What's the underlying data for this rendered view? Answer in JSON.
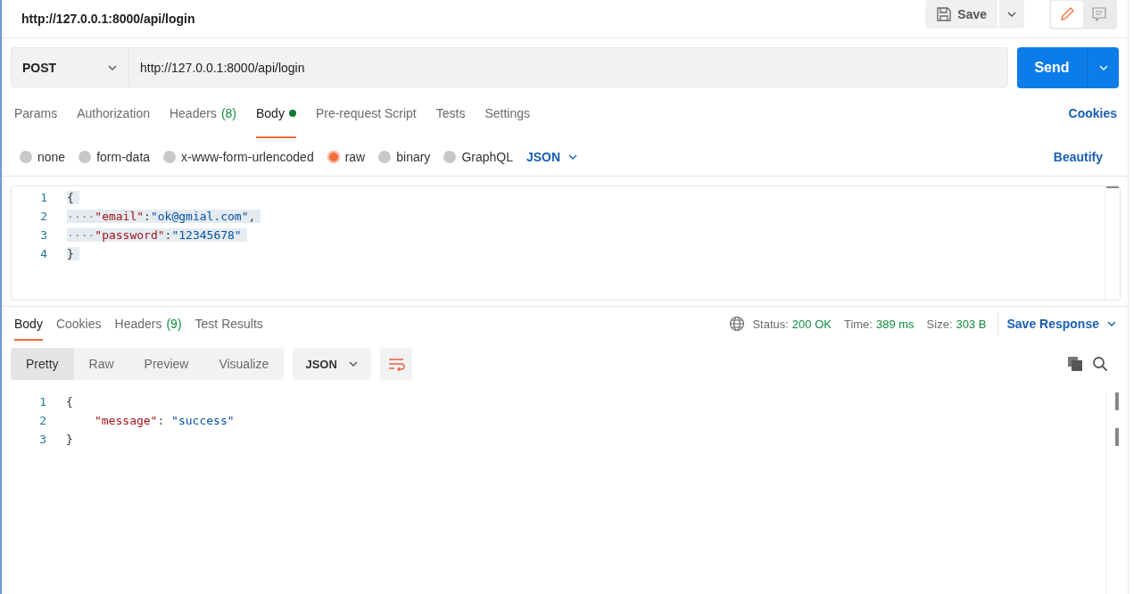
{
  "header": {
    "title": "http://127.0.0.1:8000/api/login",
    "save_label": "Save",
    "modes": [
      {
        "kind": "edit",
        "selected": true
      },
      {
        "kind": "comment",
        "selected": false
      }
    ]
  },
  "request": {
    "method": "POST",
    "url": "http://127.0.0.1:8000/api/login",
    "send_label": "Send"
  },
  "request_tabs": [
    {
      "label": "Params",
      "selected": false
    },
    {
      "label": "Authorization",
      "selected": false
    },
    {
      "label": "Headers",
      "count": "(8)",
      "selected": false
    },
    {
      "label": "Body",
      "selected": true,
      "dot": true
    },
    {
      "label": "Pre-request Script",
      "selected": false
    },
    {
      "label": "Tests",
      "selected": false
    },
    {
      "label": "Settings",
      "selected": false
    }
  ],
  "cookies_link": "Cookies",
  "body_types": [
    {
      "label": "none",
      "selected": false
    },
    {
      "label": "form-data",
      "selected": false
    },
    {
      "label": "x-www-form-urlencoded",
      "selected": false
    },
    {
      "label": "raw",
      "selected": true
    },
    {
      "label": "binary",
      "selected": false
    },
    {
      "label": "GraphQL",
      "selected": false
    }
  ],
  "body_format": "JSON",
  "beautify_link": "Beautify",
  "request_body": [
    {
      "number": "1",
      "tokens": [
        {
          "kind": "punct",
          "text": "{"
        }
      ]
    },
    {
      "number": "2",
      "tokens": [
        {
          "kind": "whitespace",
          "text": "····"
        },
        {
          "kind": "key",
          "text": "\"email\""
        },
        {
          "kind": "punct",
          "text": ":"
        },
        {
          "kind": "string",
          "text": "\"ok@gmial.com\""
        },
        {
          "kind": "punct",
          "text": ","
        }
      ]
    },
    {
      "number": "3",
      "tokens": [
        {
          "kind": "whitespace",
          "text": "····"
        },
        {
          "kind": "key",
          "text": "\"password\""
        },
        {
          "kind": "punct",
          "text": ":"
        },
        {
          "kind": "string",
          "text": "\"12345678\""
        }
      ]
    },
    {
      "number": "4",
      "tokens": [
        {
          "kind": "punct",
          "text": "}"
        }
      ]
    }
  ],
  "response_tabs": [
    {
      "label": "Body",
      "selected": true
    },
    {
      "label": "Cookies",
      "selected": false
    },
    {
      "label": "Headers",
      "count": "(9)",
      "selected": false
    },
    {
      "label": "Test Results",
      "selected": false
    }
  ],
  "response_status": [
    {
      "label": "Status:",
      "value": "200 OK"
    },
    {
      "label": "Time:",
      "value": "389 ms"
    },
    {
      "label": "Size:",
      "value": "303 B"
    }
  ],
  "save_response": "Save Response",
  "view_modes": [
    {
      "label": "Pretty",
      "selected": true
    },
    {
      "label": "Raw",
      "selected": false
    },
    {
      "label": "Preview",
      "selected": false
    },
    {
      "label": "Visualize",
      "selected": false
    }
  ],
  "response_format": "JSON",
  "response_body": [
    {
      "number": "1",
      "tokens": [
        {
          "kind": "punct",
          "text": "{"
        }
      ]
    },
    {
      "number": "2",
      "indented": true,
      "tokens": [
        {
          "kind": "key",
          "text": "\"message\""
        },
        {
          "kind": "punct",
          "text": ": "
        },
        {
          "kind": "string",
          "text": "\"success\""
        }
      ]
    },
    {
      "number": "3",
      "tokens": [
        {
          "kind": "punct",
          "text": "}"
        }
      ]
    }
  ]
}
